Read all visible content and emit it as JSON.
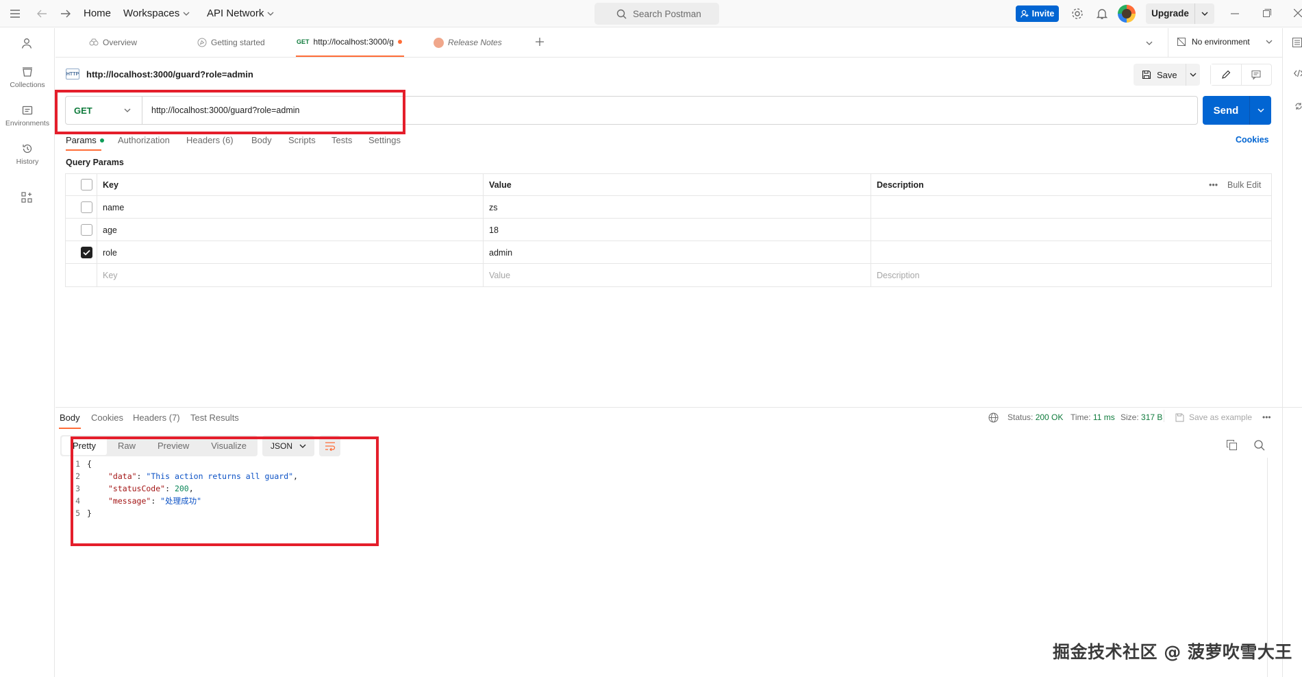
{
  "titlebar": {
    "home": "Home",
    "workspaces": "Workspaces",
    "api_network": "API Network",
    "search_placeholder": "Search Postman",
    "invite": "Invite",
    "upgrade": "Upgrade"
  },
  "sidebar": {
    "items": [
      {
        "label": "Collections",
        "icon": "collections-icon"
      },
      {
        "label": "Environments",
        "icon": "environments-icon"
      },
      {
        "label": "History",
        "icon": "history-icon"
      }
    ]
  },
  "tabs": {
    "overview": "Overview",
    "getting_started": "Getting started",
    "active_method": "GET",
    "active_url": "http://localhost:3000/g",
    "release_notes": "Release Notes",
    "environment": "No environment"
  },
  "request": {
    "title": "http://localhost:3000/guard?role=admin",
    "http_badge": "HTTP",
    "save": "Save",
    "method": "GET",
    "url": "http://localhost:3000/guard?role=admin",
    "send": "Send",
    "cookies": "Cookies",
    "subtabs": [
      "Params",
      "Authorization",
      "Headers (6)",
      "Body",
      "Scripts",
      "Tests",
      "Settings"
    ]
  },
  "params": {
    "section_title": "Query Params",
    "headers": {
      "key": "Key",
      "value": "Value",
      "description": "Description",
      "bulk_edit": "Bulk Edit"
    },
    "rows": [
      {
        "key": "name",
        "value": "zs",
        "checked": false
      },
      {
        "key": "age",
        "value": "18",
        "checked": false
      },
      {
        "key": "role",
        "value": "admin",
        "checked": true
      }
    ],
    "placeholders": {
      "key": "Key",
      "value": "Value",
      "description": "Description"
    }
  },
  "response": {
    "tabs": [
      "Body",
      "Cookies",
      "Headers (7)",
      "Test Results"
    ],
    "status_label": "Status:",
    "status_value": "200 OK",
    "time_label": "Time:",
    "time_value": "11 ms",
    "size_label": "Size:",
    "size_value": "317 B",
    "save_as_example": "Save as example",
    "modes": [
      "Pretty",
      "Raw",
      "Preview",
      "Visualize"
    ],
    "format": "JSON",
    "code": {
      "l1": "{",
      "k1": "\"data\"",
      "v1": "\"This action returns all guard\"",
      "k2": "\"statusCode\"",
      "v2": "200",
      "k3": "\"message\"",
      "v3": "\"处理成功\"",
      "l5": "}"
    }
  },
  "watermark": "掘金技术社区 @ 菠萝吹雪大王",
  "colors": {
    "accent": "#ff6c37",
    "primary": "#0265d2",
    "get_method": "#0f7b3c",
    "annotation_box": "#e41e2b"
  }
}
